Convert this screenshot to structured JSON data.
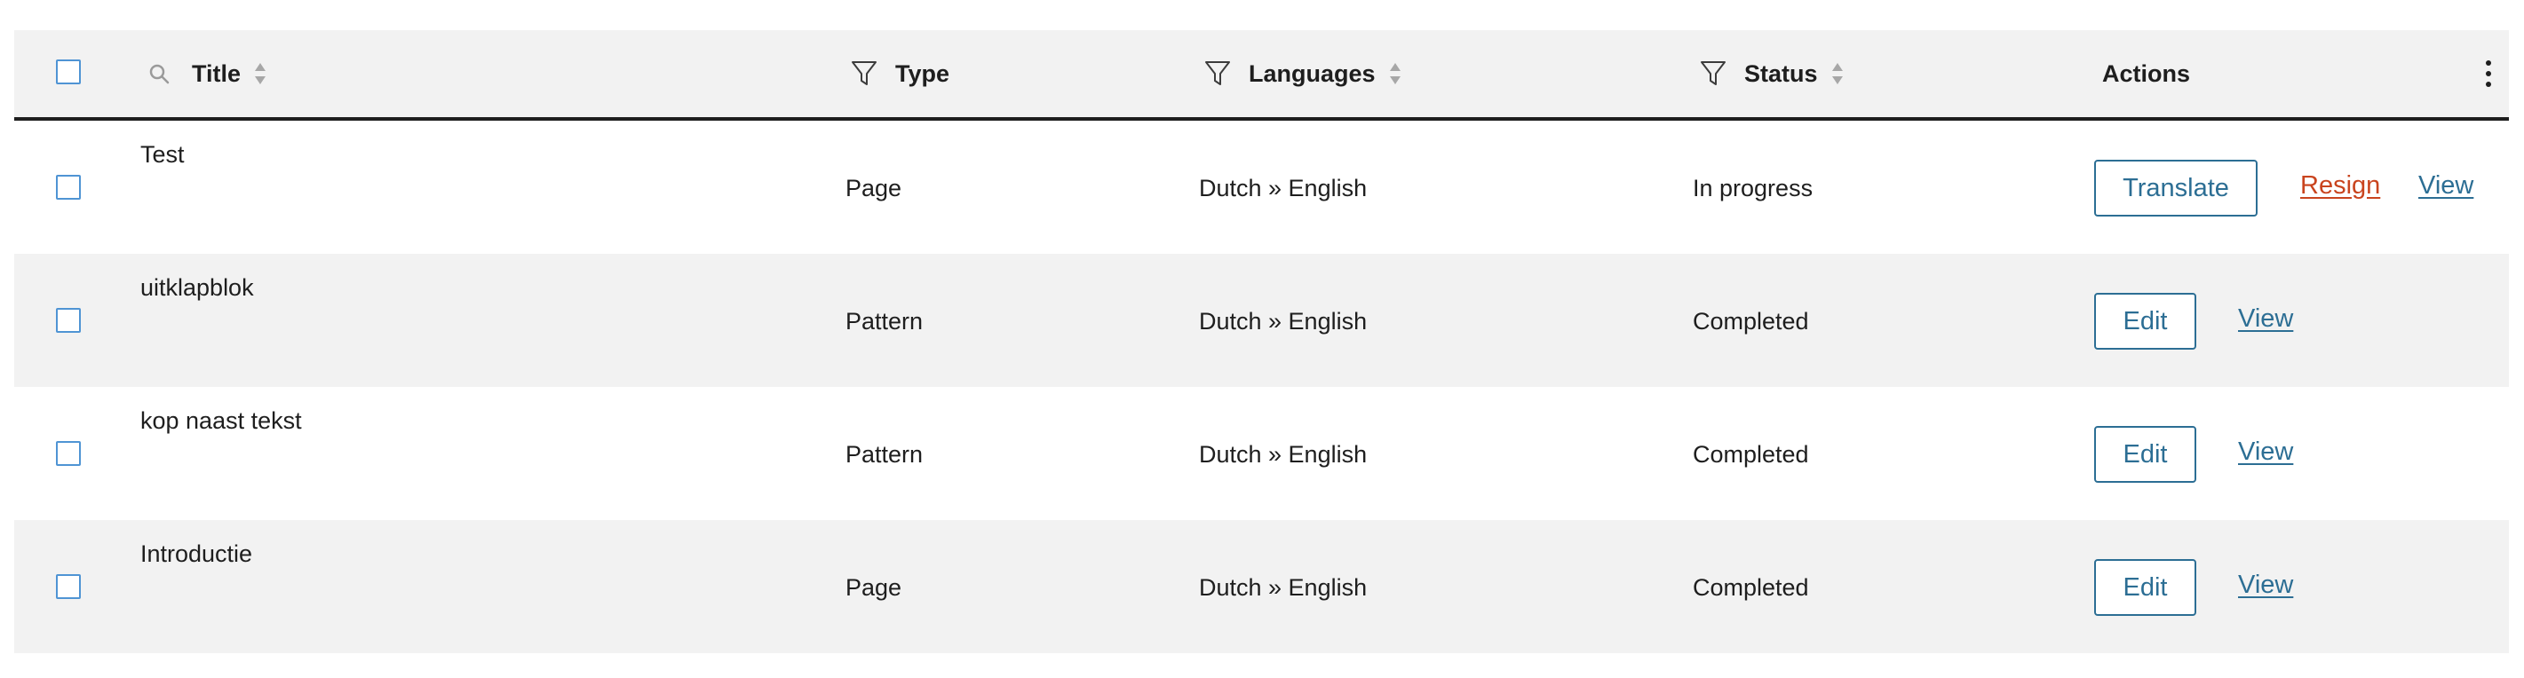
{
  "header": {
    "title": "Title",
    "type": "Type",
    "languages": "Languages",
    "status": "Status",
    "actions": "Actions"
  },
  "icons": {
    "search": "search-icon",
    "filter": "filter-icon",
    "sort": "sort-arrows-icon",
    "more": "vertical-ellipsis-icon"
  },
  "colors": {
    "accent": "#2c6e94",
    "danger": "#c9441e",
    "checkbox_border": "#4f94d4",
    "row_alt": "#f2f2f2"
  },
  "rows": [
    {
      "title": "Test",
      "type": "Page",
      "languages": "Dutch » English",
      "status": "In progress",
      "primary_action": "Translate",
      "secondary_action": "Resign",
      "view_action": "View"
    },
    {
      "title": "uitklapblok",
      "type": "Pattern",
      "languages": "Dutch » English",
      "status": "Completed",
      "primary_action": "Edit",
      "view_action": "View"
    },
    {
      "title": "kop naast tekst",
      "type": "Pattern",
      "languages": "Dutch » English",
      "status": "Completed",
      "primary_action": "Edit",
      "view_action": "View"
    },
    {
      "title": "Introductie",
      "type": "Page",
      "languages": "Dutch » English",
      "status": "Completed",
      "primary_action": "Edit",
      "view_action": "View"
    }
  ]
}
